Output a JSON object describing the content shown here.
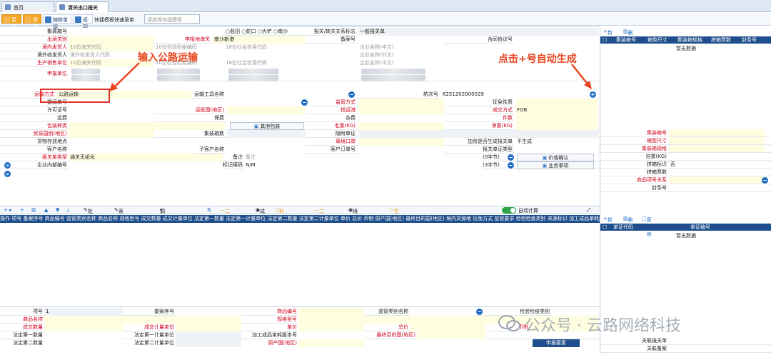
{
  "tabs": [
    {
      "label": "首页"
    },
    {
      "label": "清关出口报关"
    }
  ],
  "toolbar": {
    "save_temp": "暂存",
    "save": "保存",
    "follow_doc": "随附单据",
    "back": "返回",
    "quick_label": "快捷模板快速录单",
    "quick_placeholder": "请选择快捷模板"
  },
  "form": {
    "r1": {
      "l1": "集装箱号",
      "radios": [
        "盐田",
        "蛇口",
        "大铲",
        "南沙"
      ],
      "l2": "报关/转关关系标志",
      "v2": "一般报关单"
    },
    "r2": {
      "l1": "出境关别",
      "v1": "",
      "l2": "申报地海关",
      "v2": "南沙新港",
      "l3": "备案号",
      "l4": "合同协议号"
    },
    "r3": {
      "l1": "境内发货人",
      "p1": "10位海关代码",
      "p2": "10位检验检疫编码",
      "p3": "18位社会信用代码",
      "p4": "企业名称(中文)"
    },
    "r4": {
      "l1": "境外收发货人",
      "p1": "境外收发货人代码",
      "p4": "企业名称(外文)"
    },
    "r5": {
      "l1": "生产销售单位",
      "p1": "10位海关代码",
      "p2": "10位检验检疫编码",
      "p3": "18位社会信用代码",
      "p4": "企业名称(中文)"
    },
    "r6": {
      "l1": "申报单位"
    },
    "r7": {
      "l1": "运输方式",
      "v1": "公路运输",
      "l2": "运输工具名称",
      "l3": "航次号",
      "v3": "6251202000029"
    },
    "r8": {
      "l1": "提运单号",
      "l2": "监管方式",
      "l3": "征免性质"
    },
    "r9": {
      "l1": "许可证号",
      "l2": "运抵国(地区)",
      "l3": "指运港",
      "l4": "成交方式",
      "v4": "FOB"
    },
    "r10": {
      "l1": "运费",
      "l2": "保费",
      "l3": "杂费",
      "l4": "件数"
    },
    "r11": {
      "l1": "包装种类",
      "btn": "其他包装",
      "l3": "毛重(KG)",
      "l4": "净重(KG)"
    },
    "r12": {
      "l1": "贸易国别(地区)",
      "l2": "集装箱数",
      "l3": "随附单证"
    },
    "r13": {
      "l1": "货物存放地点",
      "l3": "离境口岸",
      "l4": "加贸是否生成报关单",
      "v4": "不生成"
    },
    "r14": {
      "l1": "客户名称",
      "l2": "子客户名称",
      "l3": "客户订单号",
      "l4": "报关单证类型"
    },
    "r15": {
      "l1": "报关单类型",
      "v1": "通关无纸化",
      "l2": "备注",
      "p2": "备注",
      "cnt": "(0字节)",
      "btn": "价格确认"
    },
    "r16": {
      "l1": "企业内部编号",
      "l2": "标记唛码",
      "v2": "N/M",
      "cnt": "(3字节)",
      "btn": "业务事项"
    }
  },
  "annotations": {
    "left": "输入公路运输",
    "right": "点击+号自动生成"
  },
  "item_toolbar": {
    "batch_modify": "批量修改",
    "table_modify": "表体批量修改",
    "fetch": "调取料号/要素",
    "copy_class": "二调取类型",
    "radio_a": "成品",
    "radio_b": "料件",
    "copy_ent": "二调取企业",
    "radio_c": "境内收发货人",
    "radio_d": "生产销售/消费使用单位",
    "auto_calc": "自动计算"
  },
  "item_header": "操作 项号 备案序号 商品编号 监管类别名称 商品名称 规格型号 成交数量 成交计量单位 法定第一数量 法定第一计量单位 法定第二数量 法定第二计量单位 单价 总价 币制 原产国(地区) 最终目的国(地区) 境内货源地 征免方式 监管要求 检验检疫类别 来源标识 加工成品单耗版本号 货号 监管资料 是否涉检",
  "bottom": {
    "r1": {
      "a": "项号",
      "av": "1",
      "b": "备案序号",
      "c": "商品编号",
      "d": "监管类别名称",
      "e": "检验检疫类别"
    },
    "r2": {
      "a": "商品名称",
      "c": "规格型号"
    },
    "r3": {
      "a": "成交数量",
      "b": "成交计量单位",
      "c": "单价",
      "d": "总价",
      "e": "币制"
    },
    "r4": {
      "a": "法定第一数量",
      "b": "法定第一计量单位",
      "c": "加工成品单耗版本号",
      "d": "最终目的国(地区)"
    },
    "r5": {
      "a": "法定第二数量",
      "b": "法定第二计量单位",
      "c": "原产国(地区)",
      "btn": "申报要素"
    }
  },
  "right": {
    "top_toolbar": {
      "add": "新增",
      "del": "删除"
    },
    "container_head": [
      "集装箱号",
      "箱型尺寸",
      "集装箱规格",
      "拼箱票数",
      "封条号"
    ],
    "nodata": "暂无数据",
    "fields": [
      {
        "label": "集装箱号",
        "req": true
      },
      {
        "label": "箱型尺寸",
        "req": true
      },
      {
        "label": "集装箱规格",
        "req": true
      },
      {
        "label": "自重(KG)",
        "req": false
      },
      {
        "label": "拼箱标识",
        "req": false,
        "value": "否"
      },
      {
        "label": "拼箱票数",
        "req": false
      },
      {
        "label": "商品项号关系",
        "req": true
      },
      {
        "label": "封条号",
        "req": false
      }
    ],
    "doc_toolbar": {
      "add": "新增",
      "del": "删除",
      "origin": "原产地"
    },
    "doc_head": [
      "单证代码",
      "单证编号"
    ],
    "bottom_fields": [
      {
        "label": "关联报关单"
      },
      {
        "label": "关联备案"
      }
    ]
  },
  "watermark": "公众号 · 云路网络科技"
}
